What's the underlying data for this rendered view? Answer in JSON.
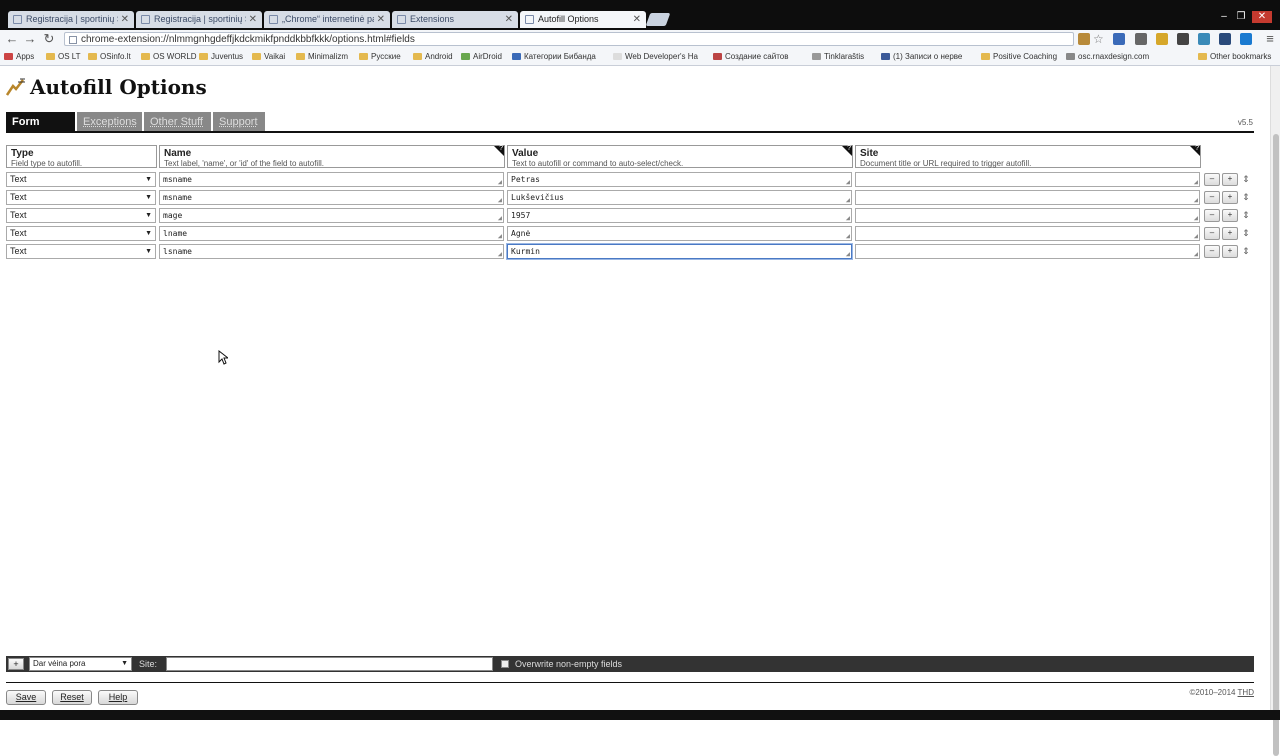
{
  "browser": {
    "tabs": [
      {
        "title": "Registracija | sportinių Soc"
      },
      {
        "title": "Registracija | sportinių Soc"
      },
      {
        "title": "„Chrome“ internetinė parc"
      },
      {
        "title": "Extensions"
      },
      {
        "title": "Autofill Options"
      }
    ],
    "url": "chrome-extension://nlmmgnhgdeffjkdckmikfpnddkbbfkkk/options.html#fields",
    "bookmarks": [
      "Apps",
      "OS LT",
      "OSinfo.lt",
      "OS WORLD",
      "Juventus",
      "Vaikai",
      "Minimalizm",
      "Русские",
      "Android",
      "AirDroid",
      "Категории Бибанда",
      "Web Developer's Ha",
      "Создание сайтов",
      "Tinklaraštis",
      "(1) Записи о нерве",
      "Positive Coaching",
      "osc.rnaxdesign.com",
      "Other bookmarks"
    ]
  },
  "page": {
    "title": "Autofill Options",
    "version": "v5.5",
    "tabs": [
      {
        "label": "Form Fields",
        "active": true
      },
      {
        "label": "Exceptions",
        "active": false
      },
      {
        "label": "Other Stuff",
        "active": false
      },
      {
        "label": "Support",
        "active": false
      }
    ],
    "headers": {
      "type": {
        "title": "Type",
        "desc": "Field type to autofill."
      },
      "name": {
        "title": "Name",
        "desc": "Text label, 'name', or 'id' of the field to autofill."
      },
      "value": {
        "title": "Value",
        "desc": "Text to autofill or command to auto-select/check."
      },
      "site": {
        "title": "Site",
        "desc": "Document title or URL required to trigger autofill."
      }
    },
    "rows": [
      {
        "type": "Text",
        "name": "msname",
        "value": "Petras",
        "site": ""
      },
      {
        "type": "Text",
        "name": "msname",
        "value": "Lukševičius",
        "site": ""
      },
      {
        "type": "Text",
        "name": "mage",
        "value": "1957",
        "site": ""
      },
      {
        "type": "Text",
        "name": "lname",
        "value": "Agnė",
        "site": ""
      },
      {
        "type": "Text",
        "name": "lsname",
        "value": "Kurmin",
        "site": ""
      }
    ],
    "row_buttons": {
      "remove": "–",
      "add": "+",
      "drag": "⇕"
    },
    "bottom": {
      "add": "+",
      "preset": "Dar vėina pora",
      "site_label": "Site:",
      "overwrite_label": "Overwrite non-empty fields"
    },
    "footer": {
      "save": "Save",
      "reset": "Reset",
      "help": "Help",
      "copyright": "©2010–2014",
      "author": "THD"
    }
  }
}
